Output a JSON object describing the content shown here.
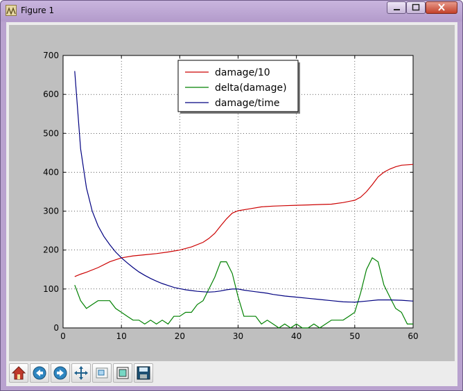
{
  "window": {
    "title": "Figure 1"
  },
  "toolbar": {
    "tools": [
      {
        "name": "home",
        "icon": "home-icon"
      },
      {
        "name": "back",
        "icon": "back-arrow-icon"
      },
      {
        "name": "forward",
        "icon": "forward-arrow-icon"
      },
      {
        "name": "pan",
        "icon": "move-icon"
      },
      {
        "name": "zoom",
        "icon": "zoom-rect-icon"
      },
      {
        "name": "subplots",
        "icon": "subplots-icon"
      },
      {
        "name": "save",
        "icon": "save-icon"
      }
    ]
  },
  "chart_data": {
    "type": "line",
    "title": "",
    "xlabel": "",
    "ylabel": "",
    "xlim": [
      0,
      60
    ],
    "ylim": [
      0,
      700
    ],
    "xticks": [
      0,
      10,
      20,
      30,
      40,
      50,
      60
    ],
    "yticks": [
      0,
      100,
      200,
      300,
      400,
      500,
      600,
      700
    ],
    "grid": true,
    "legend_position": "top-center",
    "series": [
      {
        "name": "damage/10",
        "color": "#cc0000",
        "points": [
          [
            2,
            132
          ],
          [
            3,
            138
          ],
          [
            4,
            143
          ],
          [
            6,
            155
          ],
          [
            8,
            170
          ],
          [
            10,
            180
          ],
          [
            12,
            185
          ],
          [
            14,
            188
          ],
          [
            16,
            191
          ],
          [
            18,
            195
          ],
          [
            20,
            200
          ],
          [
            22,
            208
          ],
          [
            24,
            220
          ],
          [
            25,
            230
          ],
          [
            26,
            243
          ],
          [
            27,
            262
          ],
          [
            28,
            280
          ],
          [
            29,
            295
          ],
          [
            30,
            301
          ],
          [
            32,
            306
          ],
          [
            34,
            311
          ],
          [
            36,
            313
          ],
          [
            38,
            314
          ],
          [
            40,
            315
          ],
          [
            42,
            316
          ],
          [
            44,
            317
          ],
          [
            46,
            318
          ],
          [
            48,
            322
          ],
          [
            50,
            328
          ],
          [
            51,
            336
          ],
          [
            52,
            350
          ],
          [
            53,
            368
          ],
          [
            54,
            388
          ],
          [
            55,
            400
          ],
          [
            56,
            408
          ],
          [
            57,
            414
          ],
          [
            58,
            418
          ],
          [
            60,
            420
          ]
        ]
      },
      {
        "name": "delta(damage)",
        "color": "#008000",
        "points": [
          [
            2,
            110
          ],
          [
            3,
            70
          ],
          [
            4,
            50
          ],
          [
            5,
            60
          ],
          [
            6,
            70
          ],
          [
            7,
            70
          ],
          [
            8,
            70
          ],
          [
            9,
            50
          ],
          [
            10,
            40
          ],
          [
            11,
            30
          ],
          [
            12,
            20
          ],
          [
            13,
            20
          ],
          [
            14,
            10
          ],
          [
            15,
            20
          ],
          [
            16,
            10
          ],
          [
            17,
            20
          ],
          [
            18,
            10
          ],
          [
            19,
            30
          ],
          [
            20,
            30
          ],
          [
            21,
            40
          ],
          [
            22,
            40
          ],
          [
            23,
            60
          ],
          [
            24,
            70
          ],
          [
            25,
            100
          ],
          [
            26,
            130
          ],
          [
            27,
            170
          ],
          [
            28,
            170
          ],
          [
            29,
            140
          ],
          [
            30,
            80
          ],
          [
            31,
            30
          ],
          [
            32,
            30
          ],
          [
            33,
            30
          ],
          [
            34,
            10
          ],
          [
            35,
            20
          ],
          [
            36,
            10
          ],
          [
            37,
            0
          ],
          [
            38,
            10
          ],
          [
            39,
            0
          ],
          [
            40,
            10
          ],
          [
            41,
            0
          ],
          [
            42,
            0
          ],
          [
            43,
            10
          ],
          [
            44,
            0
          ],
          [
            45,
            10
          ],
          [
            46,
            20
          ],
          [
            47,
            20
          ],
          [
            48,
            20
          ],
          [
            49,
            30
          ],
          [
            50,
            40
          ],
          [
            51,
            90
          ],
          [
            52,
            150
          ],
          [
            53,
            180
          ],
          [
            54,
            170
          ],
          [
            55,
            110
          ],
          [
            56,
            80
          ],
          [
            57,
            50
          ],
          [
            58,
            40
          ],
          [
            59,
            10
          ],
          [
            60,
            10
          ]
        ]
      },
      {
        "name": "damage/time",
        "color": "#000080",
        "points": [
          [
            2,
            660
          ],
          [
            3,
            460
          ],
          [
            4,
            360
          ],
          [
            5,
            300
          ],
          [
            6,
            262
          ],
          [
            7,
            235
          ],
          [
            8,
            214
          ],
          [
            9,
            195
          ],
          [
            10,
            180
          ],
          [
            11,
            167
          ],
          [
            12,
            155
          ],
          [
            13,
            144
          ],
          [
            14,
            135
          ],
          [
            15,
            127
          ],
          [
            16,
            120
          ],
          [
            17,
            114
          ],
          [
            18,
            109
          ],
          [
            19,
            104
          ],
          [
            20,
            101
          ],
          [
            21,
            98
          ],
          [
            22,
            96
          ],
          [
            23,
            94
          ],
          [
            24,
            93
          ],
          [
            25,
            92
          ],
          [
            26,
            93
          ],
          [
            27,
            95
          ],
          [
            28,
            98
          ],
          [
            29,
            100
          ],
          [
            30,
            100
          ],
          [
            31,
            97
          ],
          [
            32,
            95
          ],
          [
            33,
            93
          ],
          [
            34,
            91
          ],
          [
            35,
            89
          ],
          [
            36,
            86
          ],
          [
            38,
            82
          ],
          [
            40,
            79
          ],
          [
            42,
            76
          ],
          [
            44,
            73
          ],
          [
            46,
            70
          ],
          [
            48,
            67
          ],
          [
            50,
            66
          ],
          [
            52,
            69
          ],
          [
            54,
            72
          ],
          [
            56,
            72
          ],
          [
            58,
            71
          ],
          [
            60,
            69
          ]
        ]
      }
    ]
  }
}
